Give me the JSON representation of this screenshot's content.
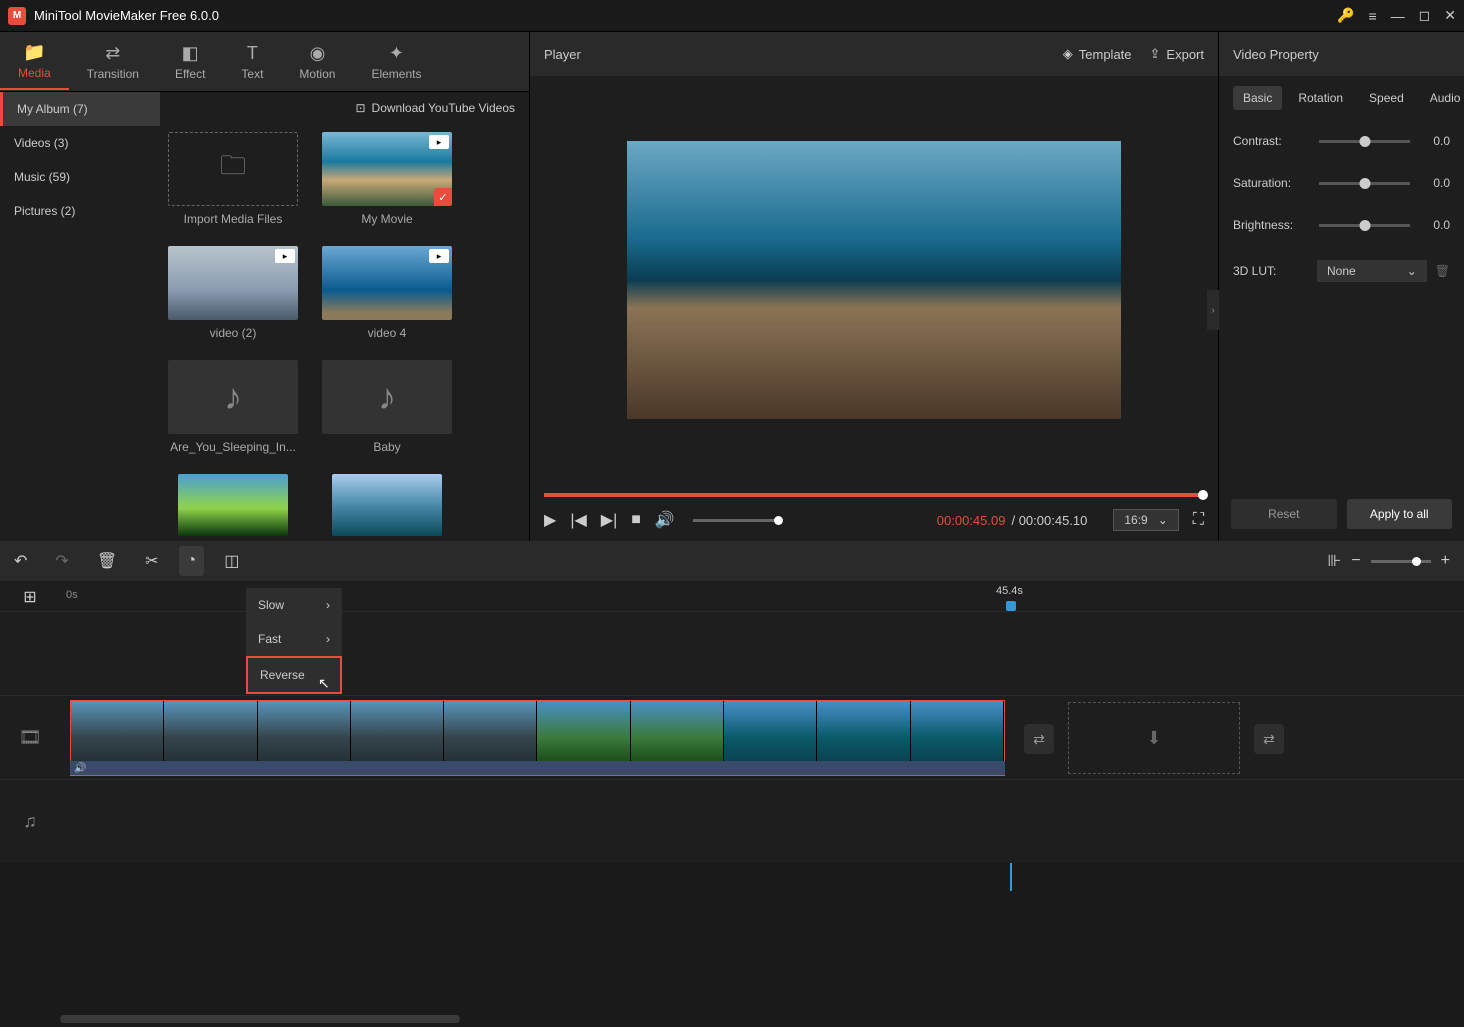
{
  "window": {
    "title": "MiniTool MovieMaker Free 6.0.0"
  },
  "topTabs": [
    {
      "label": "Media"
    },
    {
      "label": "Transition"
    },
    {
      "label": "Effect"
    },
    {
      "label": "Text"
    },
    {
      "label": "Motion"
    },
    {
      "label": "Elements"
    }
  ],
  "sidebar": {
    "items": [
      {
        "label": "My Album (7)"
      },
      {
        "label": "Videos (3)"
      },
      {
        "label": "Music (59)"
      },
      {
        "label": "Pictures (2)"
      }
    ]
  },
  "library": {
    "downloadLabel": "Download YouTube Videos",
    "items": [
      {
        "label": "Import Media Files"
      },
      {
        "label": "My Movie"
      },
      {
        "label": "video (2)"
      },
      {
        "label": "video 4"
      },
      {
        "label": "Are_You_Sleeping_In..."
      },
      {
        "label": "Baby"
      },
      {
        "label": ""
      },
      {
        "label": ""
      }
    ]
  },
  "player": {
    "title": "Player",
    "templateLabel": "Template",
    "exportLabel": "Export",
    "currentTime": "00:00:45.09",
    "totalTime": "/ 00:00:45.10",
    "aspect": "16:9"
  },
  "props": {
    "title": "Video Property",
    "tabs": [
      {
        "label": "Basic"
      },
      {
        "label": "Rotation"
      },
      {
        "label": "Speed"
      },
      {
        "label": "Audio"
      }
    ],
    "contrast": {
      "label": "Contrast:",
      "value": "0.0"
    },
    "saturation": {
      "label": "Saturation:",
      "value": "0.0"
    },
    "brightness": {
      "label": "Brightness:",
      "value": "0.0"
    },
    "lut": {
      "label": "3D LUT:",
      "value": "None"
    },
    "reset": "Reset",
    "apply": "Apply to all"
  },
  "speedMenu": {
    "items": [
      {
        "label": "Slow"
      },
      {
        "label": "Fast"
      },
      {
        "label": "Reverse"
      }
    ]
  },
  "timeline": {
    "start": "0s",
    "end": "45.4s"
  }
}
